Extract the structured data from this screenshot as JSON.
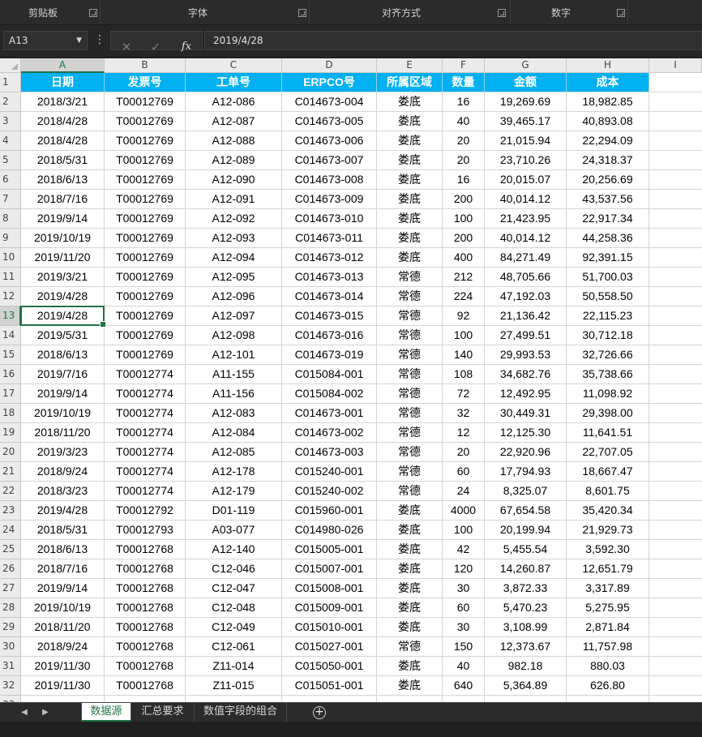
{
  "ribbon": {
    "groups": [
      {
        "label": "剪贴板"
      },
      {
        "label": "字体"
      },
      {
        "label": "对齐方式"
      },
      {
        "label": "数字"
      }
    ]
  },
  "formula_bar": {
    "name_box": "A13",
    "formula": "2019/4/28",
    "cancel_glyph": "✕",
    "enter_glyph": "✓",
    "fx_glyph": "fx"
  },
  "columns": [
    "A",
    "B",
    "C",
    "D",
    "E",
    "F",
    "G",
    "H",
    "I"
  ],
  "header_row": [
    "日期",
    "发票号",
    "工单号",
    "ERPCO号",
    "所属区域",
    "数量",
    "金额",
    "成本"
  ],
  "rows": [
    [
      "2018/3/21",
      "T00012769",
      "A12-086",
      "C014673-004",
      "娄底",
      "16",
      "19,269.69",
      "18,982.85"
    ],
    [
      "2018/4/28",
      "T00012769",
      "A12-087",
      "C014673-005",
      "娄底",
      "40",
      "39,465.17",
      "40,893.08"
    ],
    [
      "2018/4/28",
      "T00012769",
      "A12-088",
      "C014673-006",
      "娄底",
      "20",
      "21,015.94",
      "22,294.09"
    ],
    [
      "2018/5/31",
      "T00012769",
      "A12-089",
      "C014673-007",
      "娄底",
      "20",
      "23,710.26",
      "24,318.37"
    ],
    [
      "2018/6/13",
      "T00012769",
      "A12-090",
      "C014673-008",
      "娄底",
      "16",
      "20,015.07",
      "20,256.69"
    ],
    [
      "2018/7/16",
      "T00012769",
      "A12-091",
      "C014673-009",
      "娄底",
      "200",
      "40,014.12",
      "43,537.56"
    ],
    [
      "2019/9/14",
      "T00012769",
      "A12-092",
      "C014673-010",
      "娄底",
      "100",
      "21,423.95",
      "22,917.34"
    ],
    [
      "2019/10/19",
      "T00012769",
      "A12-093",
      "C014673-011",
      "娄底",
      "200",
      "40,014.12",
      "44,258.36"
    ],
    [
      "2019/11/20",
      "T00012769",
      "A12-094",
      "C014673-012",
      "娄底",
      "400",
      "84,271.49",
      "92,391.15"
    ],
    [
      "2019/3/21",
      "T00012769",
      "A12-095",
      "C014673-013",
      "常德",
      "212",
      "48,705.66",
      "51,700.03"
    ],
    [
      "2019/4/28",
      "T00012769",
      "A12-096",
      "C014673-014",
      "常德",
      "224",
      "47,192.03",
      "50,558.50"
    ],
    [
      "2019/4/28",
      "T00012769",
      "A12-097",
      "C014673-015",
      "常德",
      "92",
      "21,136.42",
      "22,115.23"
    ],
    [
      "2019/5/31",
      "T00012769",
      "A12-098",
      "C014673-016",
      "常德",
      "100",
      "27,499.51",
      "30,712.18"
    ],
    [
      "2018/6/13",
      "T00012769",
      "A12-101",
      "C014673-019",
      "常德",
      "140",
      "29,993.53",
      "32,726.66"
    ],
    [
      "2019/7/16",
      "T00012774",
      "A11-155",
      "C015084-001",
      "常德",
      "108",
      "34,682.76",
      "35,738.66"
    ],
    [
      "2019/9/14",
      "T00012774",
      "A11-156",
      "C015084-002",
      "常德",
      "72",
      "12,492.95",
      "11,098.92"
    ],
    [
      "2019/10/19",
      "T00012774",
      "A12-083",
      "C014673-001",
      "常德",
      "32",
      "30,449.31",
      "29,398.00"
    ],
    [
      "2018/11/20",
      "T00012774",
      "A12-084",
      "C014673-002",
      "常德",
      "12",
      "12,125.30",
      "11,641.51"
    ],
    [
      "2019/3/23",
      "T00012774",
      "A12-085",
      "C014673-003",
      "常德",
      "20",
      "22,920.96",
      "22,707.05"
    ],
    [
      "2018/9/24",
      "T00012774",
      "A12-178",
      "C015240-001",
      "常德",
      "60",
      "17,794.93",
      "18,667.47"
    ],
    [
      "2018/3/23",
      "T00012774",
      "A12-179",
      "C015240-002",
      "常德",
      "24",
      "8,325.07",
      "8,601.75"
    ],
    [
      "2019/4/28",
      "T00012792",
      "D01-119",
      "C015960-001",
      "娄底",
      "4000",
      "67,654.58",
      "35,420.34"
    ],
    [
      "2018/5/31",
      "T00012793",
      "A03-077",
      "C014980-026",
      "娄底",
      "100",
      "20,199.94",
      "21,929.73"
    ],
    [
      "2018/6/13",
      "T00012768",
      "A12-140",
      "C015005-001",
      "娄底",
      "42",
      "5,455.54",
      "3,592.30"
    ],
    [
      "2018/7/16",
      "T00012768",
      "C12-046",
      "C015007-001",
      "娄底",
      "120",
      "14,260.87",
      "12,651.79"
    ],
    [
      "2019/9/14",
      "T00012768",
      "C12-047",
      "C015008-001",
      "娄底",
      "30",
      "3,872.33",
      "3,317.89"
    ],
    [
      "2019/10/19",
      "T00012768",
      "C12-048",
      "C015009-001",
      "娄底",
      "60",
      "5,470.23",
      "5,275.95"
    ],
    [
      "2018/11/20",
      "T00012768",
      "C12-049",
      "C015010-001",
      "娄底",
      "30",
      "3,108.99",
      "2,871.84"
    ],
    [
      "2018/9/24",
      "T00012768",
      "C12-061",
      "C015027-001",
      "常德",
      "150",
      "12,373.67",
      "11,757.98"
    ],
    [
      "2019/11/30",
      "T00012768",
      "Z11-014",
      "C015050-001",
      "娄底",
      "40",
      "982.18",
      "880.03"
    ],
    [
      "2019/11/30",
      "T00012768",
      "Z11-015",
      "C015051-001",
      "娄底",
      "640",
      "5,364.89",
      "626.80"
    ]
  ],
  "active_cell": {
    "row": 13,
    "col": "A"
  },
  "sheet_tabs": [
    {
      "label": "数据源",
      "active": true
    },
    {
      "label": "汇总要求",
      "active": false
    },
    {
      "label": "数值字段的组合",
      "active": false
    }
  ],
  "add_sheet_glyph": "+",
  "nav_glyphs": {
    "prev": "◀",
    "next": "▶"
  },
  "colors": {
    "header_fill": "#00b0f0",
    "accent": "#217346",
    "ribbon_bg": "#2b2b2b"
  }
}
